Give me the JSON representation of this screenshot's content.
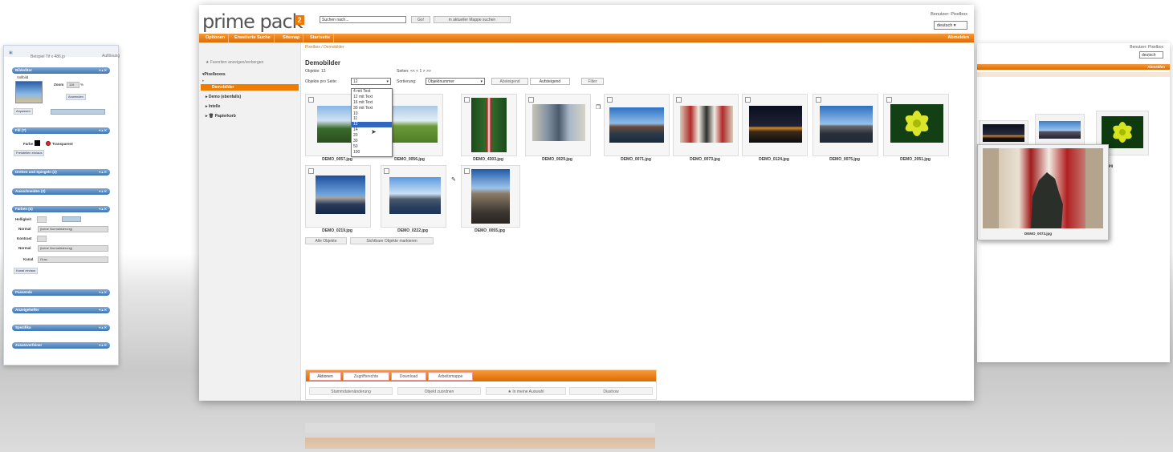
{
  "left_window": {
    "title": "Beispiel Tif x 486.jp",
    "toolbar_label": "Auflösung",
    "toolbar_select": "72 dpi",
    "toolbar_more": "< > Gro Bi",
    "panels": [
      {
        "label": "Bildeditor"
      },
      {
        "label": "Fill (?)"
      },
      {
        "label": "Drehen und Spiegeln (2)"
      },
      {
        "label": "Ausschneiden (2)"
      },
      {
        "label": "Farben (4)"
      },
      {
        "label": "Passende"
      },
      {
        "label": "Anzeigehelfer"
      },
      {
        "label": "Spezifika"
      },
      {
        "label": "Zusatzverfeiner"
      }
    ],
    "controls": {
      "vollbild": "Vollbild",
      "zoom": "Zoom",
      "zoom_val": "116",
      "pct": "%",
      "anwenden": "Anwenden",
      "anpassen": "Anpassen",
      "farbe": "Farbe",
      "transparent": "Transparent",
      "freistellen": "Freistellen ein/aus",
      "helligkeit": "Helligkeit",
      "normal1": "Normal",
      "mode_select": "(keine Normalisierung)",
      "kontrast": "Kontrast",
      "normal2": "Normal",
      "kanal": "Kanal",
      "kanal_select": "Grau",
      "kanal_btn": "Kanal ein/aus"
    }
  },
  "header": {
    "logo_text": "prime pack",
    "logo_badge": "2",
    "search_placeholder": "Suchen nach...",
    "go_label": "Go!",
    "search_in_label": "in aktueller Mappe suchen",
    "user_label": "Benutzer: Pixelbox",
    "lang_select": "deutsch"
  },
  "nav": {
    "items": [
      {
        "label": "Optionen"
      },
      {
        "label": "Erweiterte Suche"
      },
      {
        "label": "Sitemap"
      },
      {
        "label": "Startseite"
      }
    ],
    "right_label": "Abmelden"
  },
  "breadcrumb": "Pixelbox / Demobilder",
  "sidebar": {
    "favorites": "Favoriten anzeigen/verbergen",
    "root": "Pixelboxes",
    "active": "Demobilder",
    "items": [
      {
        "label": "Demo (ebenfalls)"
      },
      {
        "label": "Intelle"
      },
      {
        "label": "Papierkorb"
      }
    ]
  },
  "content": {
    "title": "Demobilder",
    "objects_count": "Objekte: 12",
    "pages": "Seiten: << < 1 > >>",
    "per_page_label": "Objekte pro Seite:",
    "per_page_value": "12",
    "sort_label": "Sortierung:",
    "sort_value": "Objektnummer",
    "ascending": "Absteigend",
    "descending": "Aufsteigend",
    "filter": "Filter",
    "dropdown_options": [
      "4 mit Text",
      "12 mit Text",
      "16 mit Text",
      "30 mit Text",
      "10",
      "11",
      "12",
      "14",
      "20",
      "30",
      "50",
      "100",
      "120"
    ],
    "dropdown_selected_index": 6,
    "thumbs": [
      {
        "name": "DEMO_0057.jpg"
      },
      {
        "name": "DEMO_0056.jpg"
      },
      {
        "name": "DEMO_4303.jpg"
      },
      {
        "name": "DEMO_0029.jpg"
      },
      {
        "name": "DEMO_0071.jpg"
      },
      {
        "name": "DEMO_0073.jpg"
      },
      {
        "name": "DEMO_0124.jpg"
      },
      {
        "name": "DEMO_0075.jpg"
      },
      {
        "name": "DEMO_2051.jpg"
      },
      {
        "name": "DEMO_0219.jpg"
      },
      {
        "name": "DEMO_0222.jpg"
      },
      {
        "name": "DEMO_0055.jpg"
      }
    ],
    "select_all": "Alle Objekte",
    "mark_visible": "Sichtbare Objekte markieren"
  },
  "bottom_panel": {
    "tabs": [
      {
        "label": "Aktionen"
      },
      {
        "label": "Zugriffsrechte"
      },
      {
        "label": "Download"
      },
      {
        "label": "Arbeitsmappe"
      }
    ],
    "buttons": [
      {
        "label": "Stammdatenänderung"
      },
      {
        "label": "Objekt zuordnen"
      },
      {
        "label": "In meine Auswahl"
      },
      {
        "label": "Diashow"
      }
    ]
  },
  "right_window": {
    "user_label": "Benutzer: Pixelbox",
    "lang_select": "deutsch",
    "nav_right": "Abmelden",
    "thumb_name_1": "DEMO_0073.jpg",
    "thumb_name_2": "n_0024.jpg"
  },
  "colors": {
    "accent_orange": "#f07d00",
    "panel_blue": "#3f77b8",
    "select_blue": "#3167c3"
  }
}
